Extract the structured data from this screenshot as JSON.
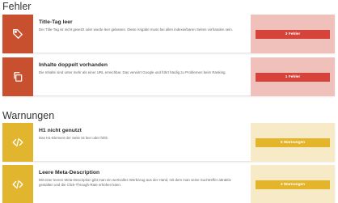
{
  "sections": {
    "errors_title": "Fehler",
    "warnings_title": "Warnungen"
  },
  "errors": [
    {
      "icon": "tag-icon",
      "title": "Title-Tag leer",
      "description": "Der Title-Tag ist nicht gesetzt oder wurde leer gelassen. Diese Angabe muss bei allen indexierbaren Seiten vorhanden sein.",
      "status_label": "3 Fehler"
    },
    {
      "icon": "copy-icon",
      "title": "Inhalte doppelt vorhanden",
      "description": "Die Inhalte sind unter mehr als einer URL erreichbar. Das verwirrt Google und führt häufig zu Problemen beim Ranking.",
      "status_label": "1 Fehler"
    }
  ],
  "warnings": [
    {
      "icon": "code-icon",
      "title": "H1 nicht genutzt",
      "description": "Das H1-Element der Seite ist leer oder fehlt.",
      "status_label": "5 Warnungen"
    },
    {
      "icon": "code-icon",
      "title": "Leere Meta-Description",
      "description": "Mit einer leeren Meta-Description gibt man ein wertvolles Werkzeug aus der Hand, mit dem man seine Suchtreffer attraktiv gestalten und die Click-Through-Rate erhöhen kann.",
      "status_label": "3 Warnungen"
    }
  ],
  "colors": {
    "error_accent": "#c9502e",
    "error_status_bg": "#f0c0bb",
    "error_button": "#d6433a",
    "warning_accent": "#e2b52e",
    "warning_status_bg": "#f6ebc6",
    "warning_button": "#e4b52b"
  }
}
